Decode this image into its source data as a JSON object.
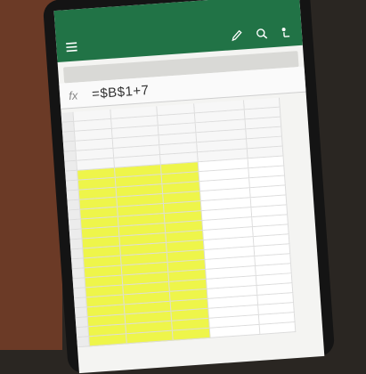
{
  "formula_bar": {
    "fx_label": "fx",
    "formula": "=$B$1+7"
  },
  "colors": {
    "app_header": "#217346",
    "highlight": "#eef54a",
    "background_left": "#6b3a26"
  },
  "icons": {
    "menu": "hamburger-menu-icon",
    "pen": "pen-icon",
    "search": "search-icon",
    "share": "share-icon"
  },
  "grid": {
    "header_rows": 6,
    "data_rows": 18,
    "columns": 6,
    "highlighted_columns": [
      1,
      2,
      3
    ]
  }
}
